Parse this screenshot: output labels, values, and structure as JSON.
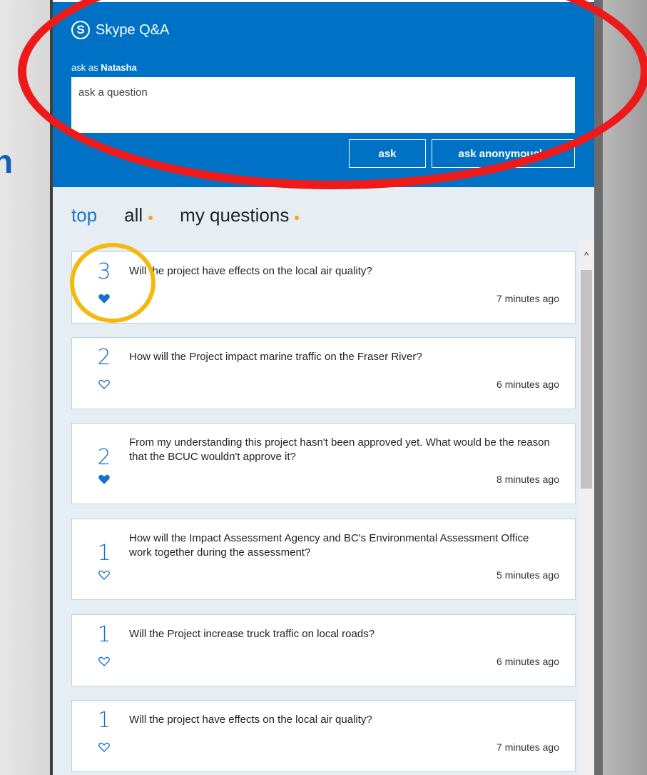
{
  "edge_text": "n",
  "header": {
    "app_title": "Skype Q&A",
    "ask_as_prefix": "ask as",
    "ask_as_name": "Natasha",
    "question_placeholder": "ask a question",
    "ask_label": "ask",
    "ask_anonymously_label": "ask anonymously"
  },
  "tabs": [
    {
      "label": "top",
      "active": true,
      "has_dot": false
    },
    {
      "label": "all",
      "active": false,
      "has_dot": true
    },
    {
      "label": "my questions",
      "active": false,
      "has_dot": true
    }
  ],
  "scrollbar": {
    "up_arrow": "^"
  },
  "questions": [
    {
      "votes": "3",
      "liked": true,
      "text": "Will the project have effects on the local air quality?",
      "time": "7 minutes ago"
    },
    {
      "votes": "2",
      "liked": false,
      "text": "How will the Project impact marine traffic on the Fraser River?",
      "time": "6 minutes ago"
    },
    {
      "votes": "2",
      "liked": true,
      "text": "From my understanding this project hasn't been approved yet. What would be the reason that the BCUC wouldn't approve it?",
      "time": "8 minutes ago"
    },
    {
      "votes": "1",
      "liked": false,
      "text": "How will the Impact Assessment Agency and BC's Environmental Assessment Office work together during the assessment?",
      "time": "5 minutes ago"
    },
    {
      "votes": "1",
      "liked": false,
      "text": "Will the Project increase truck traffic on local roads?",
      "time": "6 minutes ago"
    },
    {
      "votes": "1",
      "liked": false,
      "text": "Will the project have effects on the local air quality?",
      "time": "7 minutes ago"
    }
  ],
  "colors": {
    "header_blue": "#0072c6",
    "accent_blue": "#1570c9",
    "tab_dot": "#f7a21b",
    "annotation_red": "#ee1a1a",
    "annotation_yellow": "#f5b90e"
  }
}
